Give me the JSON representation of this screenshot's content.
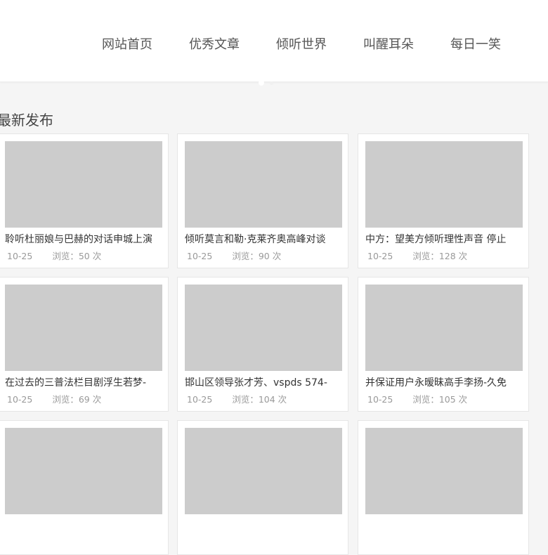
{
  "nav": {
    "items": [
      {
        "label": "网站首页"
      },
      {
        "label": "优秀文章"
      },
      {
        "label": "倾听世界"
      },
      {
        "label": "叫醒耳朵"
      },
      {
        "label": "每日一笑"
      }
    ]
  },
  "section": {
    "title": "最新发布"
  },
  "articles": [
    {
      "title": "聆听杜丽娘与巴赫的对话申城上演",
      "date": "10-25",
      "views": "浏览：50 次"
    },
    {
      "title": "倾听莫言和勒·克莱齐奥高峰对谈",
      "date": "10-25",
      "views": "浏览：90 次"
    },
    {
      "title": "中方：望美方倾听理性声音 停止",
      "date": "10-25",
      "views": "浏览：128 次"
    },
    {
      "title": "在过去的三普法栏目剧浮生若梦-",
      "date": "10-25",
      "views": "浏览：69 次"
    },
    {
      "title": "邯山区领导张才芳、vspds 574-",
      "date": "10-25",
      "views": "浏览：104 次"
    },
    {
      "title": "并保证用户永暧昧高手李扬-久免",
      "date": "10-25",
      "views": "浏览：105 次"
    },
    {
      "title": "",
      "date": "",
      "views": ""
    },
    {
      "title": "",
      "date": "",
      "views": ""
    },
    {
      "title": "",
      "date": "",
      "views": ""
    }
  ]
}
